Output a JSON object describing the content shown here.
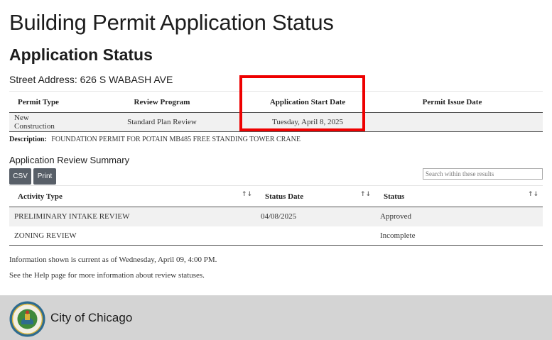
{
  "page_title": "Building Permit Application Status",
  "section_title": "Application Status",
  "street_address": "Street Address: 626 S WABASH AVE",
  "permit_table": {
    "headers": [
      "Permit Type",
      "Review Program",
      "Application Start Date",
      "Permit Issue Date"
    ],
    "row": [
      "New Construction",
      "Standard Plan Review",
      "Tuesday, April 8, 2025",
      ""
    ]
  },
  "description": {
    "label": "Description:",
    "text": "FOUNDATION PERMIT FOR POTAIN MB485 FREE STANDING TOWER CRANE"
  },
  "review_summary": {
    "title": "Application Review Summary",
    "csv_label": "CSV",
    "print_label": "Print",
    "search_placeholder": "Search within these results",
    "headers": [
      "Activity Type",
      "Status Date",
      "Status"
    ],
    "rows": [
      [
        "PRELIMINARY INTAKE REVIEW",
        "04/08/2025",
        "Approved"
      ],
      [
        "ZONING REVIEW",
        "",
        "Incomplete"
      ]
    ]
  },
  "info_current": "Information shown is current as of Wednesday, April 09, 4:00 PM.",
  "info_help": "See the Help page for more information about review statuses.",
  "footer": {
    "label": "City of Chicago",
    "seal_icon": "city-seal-icon"
  },
  "colors": {
    "highlight": "#ee0000",
    "button_bg": "#585f68",
    "footer_bg": "#d4d4d4",
    "row_alt": "#f1f1f1",
    "seal_blue": "#2e6b8f",
    "seal_green": "#3f8a3a",
    "seal_gold": "#d6b13a"
  }
}
